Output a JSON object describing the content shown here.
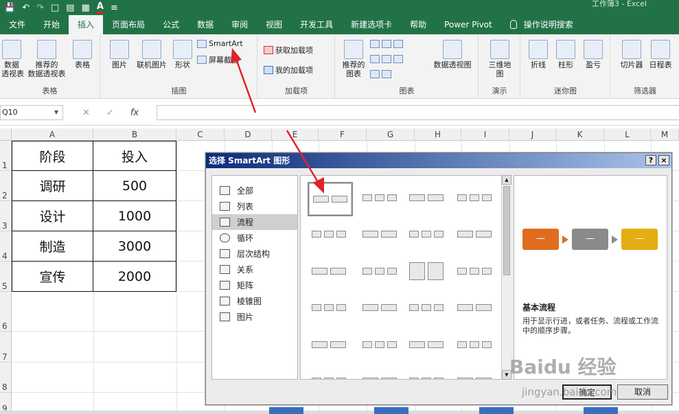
{
  "window": {
    "title": "工作簿3 - Excel"
  },
  "tabs": [
    {
      "label": "文件"
    },
    {
      "label": "开始"
    },
    {
      "label": "插入",
      "active": true
    },
    {
      "label": "页面布局"
    },
    {
      "label": "公式"
    },
    {
      "label": "数据"
    },
    {
      "label": "审阅"
    },
    {
      "label": "视图"
    },
    {
      "label": "开发工具"
    },
    {
      "label": "新建选项卡"
    },
    {
      "label": "帮助"
    },
    {
      "label": "Power Pivot"
    },
    {
      "label": "操作说明搜索"
    }
  ],
  "ribbon": {
    "groups": {
      "tables": "表格",
      "illustrations": "插图",
      "addins": "加载项",
      "charts": "图表",
      "tours": "演示",
      "sparklines": "迷你图",
      "filters": "筛选器"
    },
    "buttons": {
      "pivot_table": "数据\n透视表",
      "recommended_pivot": "推荐的\n数据透视表",
      "table": "表格",
      "pictures": "图片",
      "online_pictures": "联机图片",
      "shapes": "形状",
      "smartart": "SmartArt",
      "screenshot": "屏幕截图",
      "get_addins": "获取加载项",
      "my_addins": "我的加载项",
      "recommended_charts": "推荐的\n图表",
      "pivot_chart": "数据透视图",
      "map_3d": "三维地\n图",
      "line": "折线",
      "column": "柱形",
      "win_loss": "盈亏",
      "slicer": "切片器",
      "timeline": "日程表"
    }
  },
  "formula_bar": {
    "name_box": "Q10",
    "fx": "fx",
    "formula": ""
  },
  "sheet": {
    "columns": [
      "A",
      "B",
      "C",
      "D",
      "E",
      "F",
      "G",
      "H",
      "I",
      "J",
      "K",
      "L",
      "M"
    ],
    "rows": [
      "1",
      "2",
      "3",
      "4",
      "5",
      "6",
      "7",
      "8",
      "9"
    ],
    "table": {
      "header": [
        "阶段",
        "投入"
      ],
      "rows": [
        [
          "调研",
          "500"
        ],
        [
          "设计",
          "1000"
        ],
        [
          "制造",
          "3000"
        ],
        [
          "宣传",
          "2000"
        ]
      ]
    }
  },
  "dialog": {
    "title": "选择 SmartArt 图形",
    "help": "?",
    "close": "×",
    "categories": [
      {
        "label": "全部",
        "icon": "all-icon"
      },
      {
        "label": "列表",
        "icon": "list-icon"
      },
      {
        "label": "流程",
        "icon": "process-icon",
        "selected": true
      },
      {
        "label": "循环",
        "icon": "cycle-icon"
      },
      {
        "label": "层次结构",
        "icon": "hierarchy-icon"
      },
      {
        "label": "关系",
        "icon": "relationship-icon"
      },
      {
        "label": "矩阵",
        "icon": "matrix-icon"
      },
      {
        "label": "棱锥图",
        "icon": "pyramid-icon"
      },
      {
        "label": "图片",
        "icon": "picture-icon"
      }
    ],
    "preview": {
      "box_text": "—",
      "colors": [
        "#e06d1e",
        "#8a8a8a",
        "#e4ad12"
      ],
      "title": "基本流程",
      "description": "用于显示行进，或者任务、流程或工作流中的顺序步骤。"
    },
    "ok": "确定",
    "cancel": "取消"
  },
  "watermark": {
    "logo": "Baidu 经验",
    "url": "jingyan.baidu.com"
  },
  "colors": {
    "excel_green": "#217346",
    "annotation_red": "#e0222a"
  }
}
